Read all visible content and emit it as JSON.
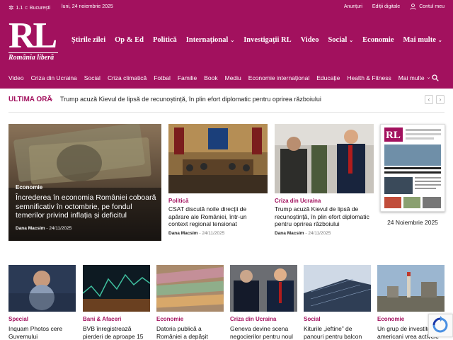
{
  "topbar": {
    "temp": "1.1",
    "unit": "C",
    "city": "București",
    "date": "luni, 24 noiembrie 2025",
    "ads": "Anunțuri",
    "digital": "Ediții digitale",
    "account": "Contul meu"
  },
  "logo": {
    "letters": "RL",
    "sub": "România liberă"
  },
  "main_nav": [
    "Știrile zilei",
    "Op & Ed",
    "Politică",
    "Internațional",
    "Investigații RL",
    "Video",
    "Social",
    "Economie",
    "Mai multe"
  ],
  "sub_nav": [
    "Video",
    "Criza din Ucraina",
    "Social",
    "Criza climatică",
    "Fotbal",
    "Familie",
    "Book",
    "Mediu",
    "Economie internațional",
    "Educație",
    "Health & Fitness",
    "Mai multe"
  ],
  "breaking": {
    "label": "ULTIMA ORĂ",
    "text": "Trump acuză Kievul de lipsă de recunoștință, în plin efort diplomatic pentru oprirea războiului"
  },
  "hero": {
    "category": "Economie",
    "title": "Încrederea în economia României coboară semnificativ în octombrie, pe fondul temerilor privind inflația și deficitul",
    "author": "Dana Macsim",
    "date": "24/11/2025"
  },
  "cards": [
    {
      "category": "Politică",
      "title": "CSAT discută noile direcții de apărare ale României, într-un context regional tensionat",
      "author": "Dana Macsim",
      "date": "24/11/2025"
    },
    {
      "category": "Criza din Ucraina",
      "title": "Trump acuză Kievul de lipsă de recunoștință, în plin efort diplomatic pentru oprirea războiului",
      "author": "Dana Macsim",
      "date": "24/11/2025"
    }
  ],
  "paper": {
    "date": "24 Noiembrie 2025"
  },
  "row2": [
    {
      "category": "Special",
      "title": "Inquam Photos cere Guvernului"
    },
    {
      "category": "Bani & Afaceri",
      "title": "BVB înregistrează pierderi de aproape 15"
    },
    {
      "category": "Economie",
      "title": "Datoria publică a României a depășit"
    },
    {
      "category": "Criza din Ucraina",
      "title": "Geneva devine scena negocierilor pentru noul"
    },
    {
      "category": "Social",
      "title": "Kiturile „ieftine” de panouri pentru balcon"
    },
    {
      "category": "Economie",
      "title": "Un grup de investitori americani vrea activele"
    }
  ]
}
